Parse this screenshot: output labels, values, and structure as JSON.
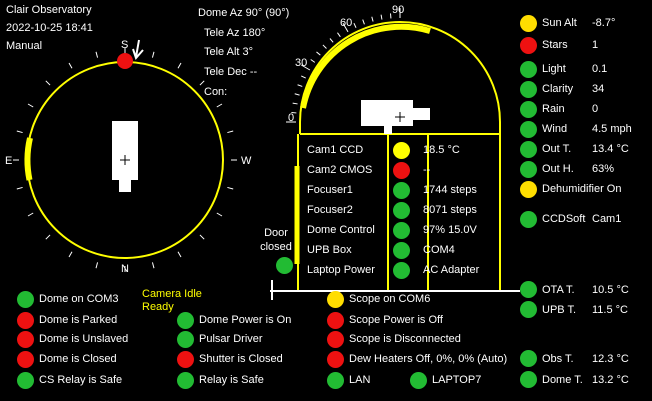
{
  "header": {
    "observatory": "Clair Observatory",
    "datetime": "2022-10-25  18:41",
    "mode": "Manual"
  },
  "telemetry": {
    "dome_az": "Dome Az 90° (90°)",
    "tele_az": "Tele Az 180°",
    "tele_alt": "Tele Alt 3°",
    "tele_dec": "Tele Dec --",
    "con": "Con:"
  },
  "compass": {
    "n": "N",
    "s": "S",
    "e": "E",
    "w": "W"
  },
  "altitude_scale": {
    "labels": [
      "0",
      "30",
      "60",
      "90"
    ]
  },
  "door": {
    "label_line1": "Door",
    "label_line2": "closed",
    "color": "#22bb33"
  },
  "dome_devices": [
    {
      "name": "Cam1 CCD",
      "value": "18.5 °C",
      "color": "#ffff00"
    },
    {
      "name": "Cam2 CMOS",
      "value": "--",
      "color": "#ee1111"
    },
    {
      "name": "Focuser1",
      "value": "1744 steps",
      "color": "#22bb33"
    },
    {
      "name": "Focuser2",
      "value": "8071 steps",
      "color": "#22bb33"
    },
    {
      "name": "Dome Control",
      "value": "97%  15.0V",
      "color": "#22bb33"
    },
    {
      "name": "UPB Box",
      "value": "COM4",
      "color": "#22bb33"
    },
    {
      "name": "Laptop Power",
      "value": "AC Adapter",
      "color": "#22bb33"
    }
  ],
  "camera_status": {
    "line1": "Camera Idle",
    "line2": "Ready"
  },
  "weather": [
    {
      "label": "Sun Alt",
      "value": "-8.7°",
      "color": "#ffdd00"
    },
    {
      "label": "Stars",
      "value": "1",
      "color": "#ee1111"
    },
    {
      "label": "Light",
      "value": "0.1",
      "color": "#22bb33"
    },
    {
      "label": "Clarity",
      "value": "34",
      "color": "#22bb33"
    },
    {
      "label": "Rain",
      "value": "0",
      "color": "#22bb33"
    },
    {
      "label": "Wind",
      "value": "4.5 mph",
      "color": "#22bb33"
    },
    {
      "label": "Out T.",
      "value": "13.4 °C",
      "color": "#22bb33"
    },
    {
      "label": "Out H.",
      "value": "63%",
      "color": "#22bb33"
    },
    {
      "label": "Dehumidifier On",
      "value": "",
      "color": "#ffdd00"
    },
    {
      "label": "CCDSoft",
      "value": "Cam1",
      "color": "#22bb33"
    }
  ],
  "temps": [
    {
      "label": "OTA T.",
      "value": "10.5 °C",
      "color": "#22bb33"
    },
    {
      "label": "UPB T.",
      "value": "11.5 °C",
      "color": "#22bb33"
    },
    {
      "label": "Obs T.",
      "value": "12.3 °C",
      "color": "#22bb33"
    },
    {
      "label": "Dome T.",
      "value": "13.2 °C",
      "color": "#22bb33"
    }
  ],
  "status": {
    "col1": [
      {
        "text": "Dome on COM3",
        "color": "#22bb33"
      },
      {
        "text": "Dome is Parked",
        "color": "#ee1111"
      },
      {
        "text": "Dome is Unslaved",
        "color": "#ee1111"
      },
      {
        "text": "Dome is Closed",
        "color": "#ee1111"
      },
      {
        "text": "CS Relay is Safe",
        "color": "#22bb33"
      }
    ],
    "col2": [
      {
        "text": "Dome Power is On",
        "color": "#22bb33"
      },
      {
        "text": "Pulsar Driver",
        "color": "#22bb33"
      },
      {
        "text": "Shutter is Closed",
        "color": "#ee1111"
      },
      {
        "text": "Relay is Safe",
        "color": "#22bb33"
      }
    ],
    "col3": [
      {
        "text": "Scope on COM6",
        "color": "#ffdd00"
      },
      {
        "text": "Scope Power is Off",
        "color": "#ee1111"
      },
      {
        "text": "Scope is Disconnected",
        "color": "#ee1111"
      },
      {
        "text": "Dew Heaters Off, 0%, 0% (Auto)",
        "color": "#ee1111"
      },
      {
        "text": "LAN",
        "color": "#22bb33"
      }
    ],
    "laptop": {
      "text": "LAPTOP7",
      "color": "#22bb33"
    }
  }
}
